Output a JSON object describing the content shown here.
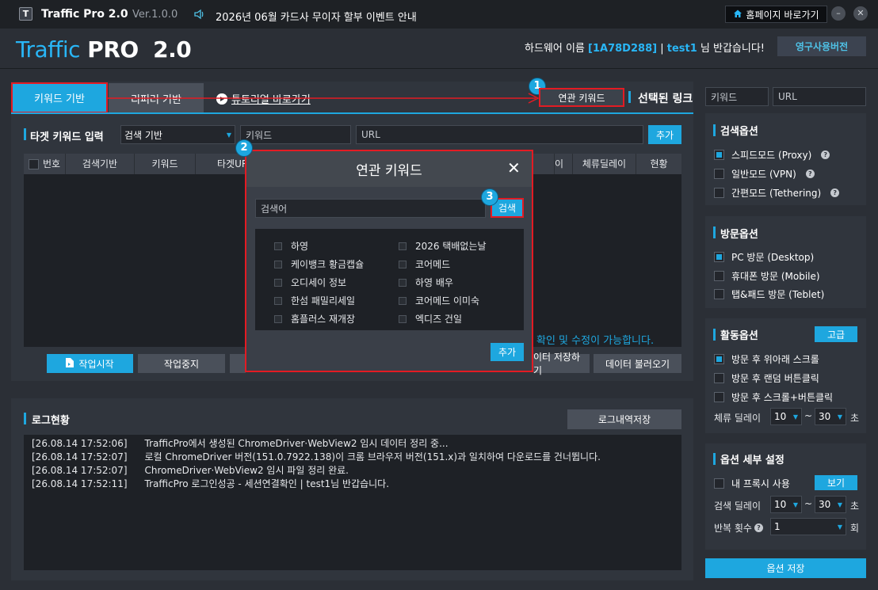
{
  "titlebar": {
    "logo_glyph": "T",
    "app_name": "Traffic Pro 2.0",
    "version": "Ver.1.0.0",
    "notice": "2026년 06월 카드사 무이자 할부 이벤트 안내",
    "home_button": "홈페이지 바로가기",
    "minimize_glyph": "–",
    "close_glyph": "✕"
  },
  "header": {
    "brand_traffic": "Traffic",
    "brand_pro": " PRO  2.0",
    "hw_prefix": "하드웨어 이름",
    "hw_id": "[1A78D288]",
    "separator": "|",
    "user": "test1",
    "greeting": "님 반갑습니다!",
    "license_button": "영구사용버전"
  },
  "tabs": {
    "keyword_tab": "키워드 기반",
    "referrer_tab": "리퍼러 기반",
    "tutorial_link": "튜토리얼 바로가기",
    "related_keyword_button": "연관 키워드",
    "selected_link_label": "선택된 링크",
    "right_keyword_input": "키워드",
    "right_url_input": "URL"
  },
  "target_input": {
    "label": "타겟 키워드 입력",
    "search_base_select": "검색 기반",
    "keyword_placeholder": "키워드",
    "url_placeholder": "URL",
    "add_button": "추가"
  },
  "table": {
    "columns": [
      "번호",
      "검색기반",
      "키워드",
      "타겟URL",
      "",
      "",
      "",
      "",
      "",
      "체류딜레이",
      "현황"
    ],
    "visible_columns": {
      "col1": "번호",
      "col2": "검색기반",
      "col3": "키워드",
      "col4": "타겟UR",
      "col_hidden": "이",
      "col_delay": "체류딜레이",
      "col_status": "현황"
    },
    "rows": [],
    "footer_message": "확인 및 수정이 가능합니다."
  },
  "actions": {
    "start": "작업시작",
    "stop": "작업중지",
    "save_data": "데이터 저장하기",
    "save_data_visible": "이터 저장하기",
    "load_data": "데이터 불러오기"
  },
  "log": {
    "title": "로그현황",
    "save_button": "로그내역저장",
    "entries": [
      {
        "time": "[26.08.14 17:52:06]",
        "message": "TrafficPro에서 생성된 ChromeDriver·WebView2 임시 데이터 정리 중..."
      },
      {
        "time": "[26.08.14 17:52:07]",
        "message": "로컬 ChromeDriver 버전(151.0.7922.138)이 크롬 브라우저 버전(151.x)과 일치하여 다운로드를 건너뜁니다."
      },
      {
        "time": "[26.08.14 17:52:07]",
        "message": "ChromeDriver·WebView2 임시 파일 정리 완료."
      },
      {
        "time": "[26.08.14 17:52:11]",
        "message": "TrafficPro 로그인성공 - 세션연결확인  | test1님 반갑습니다."
      }
    ]
  },
  "search_options": {
    "title": "검색옵션",
    "items": [
      {
        "label": "스피드모드 (Proxy)",
        "checked": true
      },
      {
        "label": "일반모드 (VPN)",
        "checked": false
      },
      {
        "label": "간편모드 (Tethering)",
        "checked": false
      }
    ]
  },
  "visit_options": {
    "title": "방문옵션",
    "items": [
      {
        "label": "PC 방문 (Desktop)",
        "checked": true
      },
      {
        "label": "휴대폰 방문 (Mobile)",
        "checked": false
      },
      {
        "label": "탭&패드 방문 (Teblet)",
        "checked": false
      }
    ]
  },
  "activity_options": {
    "title": "활동옵션",
    "advanced_button": "고급",
    "items": [
      {
        "label": "방문 후 위아래 스크롤",
        "checked": true
      },
      {
        "label": "방문 후 랜덤 버튼클릭",
        "checked": false
      },
      {
        "label": "방문 후 스크롤+버튼클릭",
        "checked": false
      }
    ],
    "dwell_label": "체류 딜레이",
    "dwell_min": "10",
    "dwell_tilde": "~",
    "dwell_max": "30",
    "unit": "초"
  },
  "detail_options": {
    "title": "옵션 세부 설정",
    "proxy_label": "내 프록시 사용",
    "proxy_checked": false,
    "view_button": "보기",
    "search_delay_label": "검색 딜레이",
    "search_delay_min": "10",
    "search_delay_tilde": "~",
    "search_delay_max": "30",
    "unit": "초",
    "repeat_label": "반복 횟수",
    "repeat_value": "1",
    "repeat_unit": "회"
  },
  "save_options_button": "옵션 저장",
  "modal": {
    "title": "연관 키워드",
    "search_placeholder": "검색어",
    "search_button": "검색",
    "add_button": "추가",
    "keywords_left": [
      "하영",
      "케이뱅크 황금캡슐",
      "오디세이 정보",
      "한섬 패밀리세일",
      "홈플러스 재개장"
    ],
    "keywords_right": [
      "2026 택배없는날",
      "코어메드",
      "하영 배우",
      "코어메드 이미숙",
      "엑디즈 건일"
    ]
  },
  "badges": {
    "one": "1",
    "two": "2",
    "three": "3"
  },
  "colors": {
    "accent": "#1ea7df",
    "highlight_border": "#e31b23",
    "background": "#2b2f36",
    "panel": "#30353d"
  }
}
